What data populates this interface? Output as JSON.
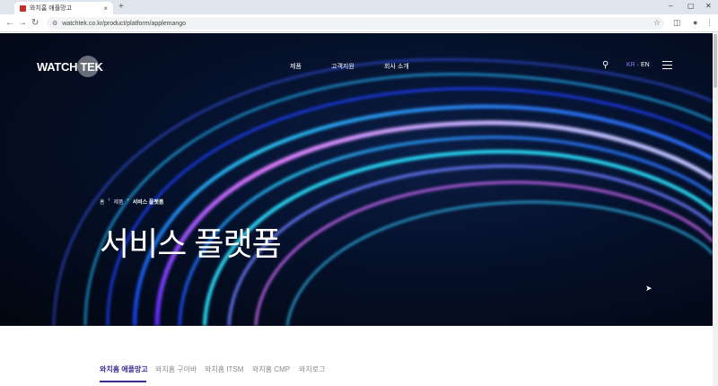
{
  "browser": {
    "tab_title": "와치홈 애플망고",
    "tab_close": "×",
    "new_tab": "+",
    "url": "watchtek.co.kr/product/platform/applemango",
    "win_min": "–",
    "win_max": "▢",
    "win_close": "✕"
  },
  "header": {
    "logo": "WATCH TEK",
    "menu": [
      "제품",
      "고객지원",
      "회사 소개"
    ],
    "lang_kr": "KR",
    "lang_sep": " · ",
    "lang_en": "EN"
  },
  "breadcrumb": {
    "home": "홈",
    "sep": "›",
    "level1": "제품",
    "level2": "서비스 플랫폼"
  },
  "hero": {
    "title": "서비스 플랫폼"
  },
  "subnav": {
    "tabs": [
      "와치홈 애플망고",
      "와치홈 구아바",
      "와치홈 ITSM",
      "와치홈 CMP",
      "와치로그"
    ]
  },
  "colors": {
    "accent": "#3c2a8f",
    "lang_active": "#8e7bff",
    "hero_bg": "#05102a"
  }
}
